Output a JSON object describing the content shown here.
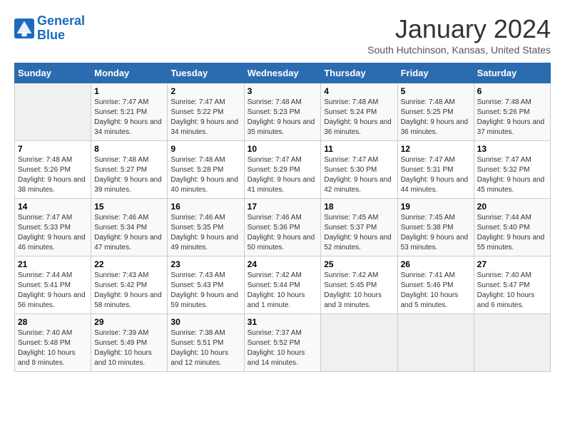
{
  "header": {
    "logo_line1": "General",
    "logo_line2": "Blue",
    "month": "January 2024",
    "location": "South Hutchinson, Kansas, United States"
  },
  "weekdays": [
    "Sunday",
    "Monday",
    "Tuesday",
    "Wednesday",
    "Thursday",
    "Friday",
    "Saturday"
  ],
  "weeks": [
    [
      {
        "day": "",
        "empty": true
      },
      {
        "day": "1",
        "sunrise": "7:47 AM",
        "sunset": "5:21 PM",
        "daylight": "9 hours and 34 minutes."
      },
      {
        "day": "2",
        "sunrise": "7:47 AM",
        "sunset": "5:22 PM",
        "daylight": "9 hours and 34 minutes."
      },
      {
        "day": "3",
        "sunrise": "7:48 AM",
        "sunset": "5:23 PM",
        "daylight": "9 hours and 35 minutes."
      },
      {
        "day": "4",
        "sunrise": "7:48 AM",
        "sunset": "5:24 PM",
        "daylight": "9 hours and 36 minutes."
      },
      {
        "day": "5",
        "sunrise": "7:48 AM",
        "sunset": "5:25 PM",
        "daylight": "9 hours and 36 minutes."
      },
      {
        "day": "6",
        "sunrise": "7:48 AM",
        "sunset": "5:26 PM",
        "daylight": "9 hours and 37 minutes."
      }
    ],
    [
      {
        "day": "7",
        "sunrise": "7:48 AM",
        "sunset": "5:26 PM",
        "daylight": "9 hours and 38 minutes."
      },
      {
        "day": "8",
        "sunrise": "7:48 AM",
        "sunset": "5:27 PM",
        "daylight": "9 hours and 39 minutes."
      },
      {
        "day": "9",
        "sunrise": "7:48 AM",
        "sunset": "5:28 PM",
        "daylight": "9 hours and 40 minutes."
      },
      {
        "day": "10",
        "sunrise": "7:47 AM",
        "sunset": "5:29 PM",
        "daylight": "9 hours and 41 minutes."
      },
      {
        "day": "11",
        "sunrise": "7:47 AM",
        "sunset": "5:30 PM",
        "daylight": "9 hours and 42 minutes."
      },
      {
        "day": "12",
        "sunrise": "7:47 AM",
        "sunset": "5:31 PM",
        "daylight": "9 hours and 44 minutes."
      },
      {
        "day": "13",
        "sunrise": "7:47 AM",
        "sunset": "5:32 PM",
        "daylight": "9 hours and 45 minutes."
      }
    ],
    [
      {
        "day": "14",
        "sunrise": "7:47 AM",
        "sunset": "5:33 PM",
        "daylight": "9 hours and 46 minutes."
      },
      {
        "day": "15",
        "sunrise": "7:46 AM",
        "sunset": "5:34 PM",
        "daylight": "9 hours and 47 minutes."
      },
      {
        "day": "16",
        "sunrise": "7:46 AM",
        "sunset": "5:35 PM",
        "daylight": "9 hours and 49 minutes."
      },
      {
        "day": "17",
        "sunrise": "7:46 AM",
        "sunset": "5:36 PM",
        "daylight": "9 hours and 50 minutes."
      },
      {
        "day": "18",
        "sunrise": "7:45 AM",
        "sunset": "5:37 PM",
        "daylight": "9 hours and 52 minutes."
      },
      {
        "day": "19",
        "sunrise": "7:45 AM",
        "sunset": "5:38 PM",
        "daylight": "9 hours and 53 minutes."
      },
      {
        "day": "20",
        "sunrise": "7:44 AM",
        "sunset": "5:40 PM",
        "daylight": "9 hours and 55 minutes."
      }
    ],
    [
      {
        "day": "21",
        "sunrise": "7:44 AM",
        "sunset": "5:41 PM",
        "daylight": "9 hours and 56 minutes."
      },
      {
        "day": "22",
        "sunrise": "7:43 AM",
        "sunset": "5:42 PM",
        "daylight": "9 hours and 58 minutes."
      },
      {
        "day": "23",
        "sunrise": "7:43 AM",
        "sunset": "5:43 PM",
        "daylight": "9 hours and 59 minutes."
      },
      {
        "day": "24",
        "sunrise": "7:42 AM",
        "sunset": "5:44 PM",
        "daylight": "10 hours and 1 minute."
      },
      {
        "day": "25",
        "sunrise": "7:42 AM",
        "sunset": "5:45 PM",
        "daylight": "10 hours and 3 minutes."
      },
      {
        "day": "26",
        "sunrise": "7:41 AM",
        "sunset": "5:46 PM",
        "daylight": "10 hours and 5 minutes."
      },
      {
        "day": "27",
        "sunrise": "7:40 AM",
        "sunset": "5:47 PM",
        "daylight": "10 hours and 6 minutes."
      }
    ],
    [
      {
        "day": "28",
        "sunrise": "7:40 AM",
        "sunset": "5:48 PM",
        "daylight": "10 hours and 8 minutes."
      },
      {
        "day": "29",
        "sunrise": "7:39 AM",
        "sunset": "5:49 PM",
        "daylight": "10 hours and 10 minutes."
      },
      {
        "day": "30",
        "sunrise": "7:38 AM",
        "sunset": "5:51 PM",
        "daylight": "10 hours and 12 minutes."
      },
      {
        "day": "31",
        "sunrise": "7:37 AM",
        "sunset": "5:52 PM",
        "daylight": "10 hours and 14 minutes."
      },
      {
        "day": "",
        "empty": true
      },
      {
        "day": "",
        "empty": true
      },
      {
        "day": "",
        "empty": true
      }
    ]
  ]
}
